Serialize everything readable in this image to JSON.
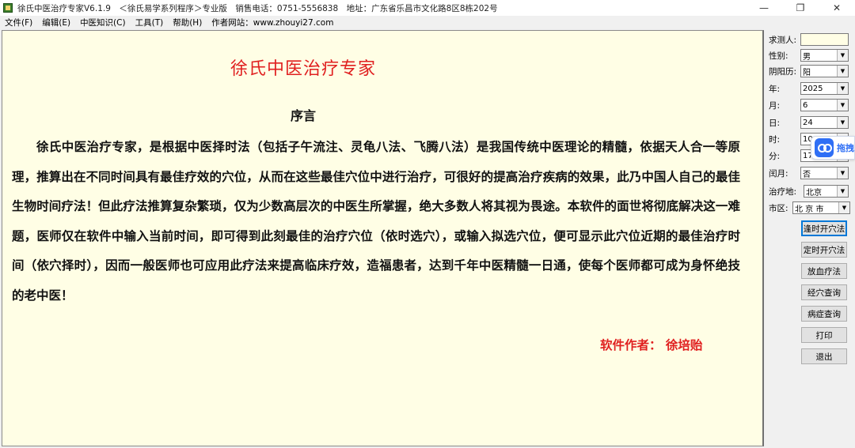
{
  "window": {
    "title": "徐氏中医治疗专家V6.1.9　＜徐氏易学系列程序＞专业版　销售电话：0751-5556838　地址：广东省乐昌市文化路8区8栋202号",
    "minimize_glyph": "—",
    "maximize_glyph": "❐",
    "close_glyph": "✕"
  },
  "menu": {
    "items": [
      "文件(F)",
      "编辑(E)",
      "中医知识(C)",
      "工具(T)",
      "帮助(H)"
    ],
    "website": "作者网站：www.zhouyi27.com"
  },
  "document": {
    "title": "徐氏中医治疗专家",
    "heading": "序言",
    "body": "徐氏中医治疗专家，是根据中医择时法（包括子午流注、灵龟八法、飞腾八法）是我国传统中医理论的精髓，依据天人合一等原理，推算出在不同时间具有最佳疗效的穴位，从而在这些最佳穴位中进行治疗，可很好的提高治疗疾病的效果，此乃中国人自己的最佳生物时间疗法！但此疗法推算复杂繁琐，仅为少数高层次的中医生所掌握，绝大多数人将其视为畏途。本软件的面世将彻底解决这一难题，医师仅在软件中输入当前时间，即可得到此刻最佳的治疗穴位（依时选穴），或输入拟选穴位，便可显示此穴位近期的最佳治疗时间（依穴择时），因而一般医师也可应用此疗法来提高临床疗效，造福患者，达到千年中医精髓一日通，使每个医师都可成为身怀绝技的老中医！",
    "author": "软件作者：  徐培贻"
  },
  "form": {
    "requester_label": "求测人:",
    "requester_value": "",
    "gender_label": "性别:",
    "gender_value": "男",
    "calendar_label": "阴阳历:",
    "calendar_value": "阳",
    "year_label": "年:",
    "year_value": "2025",
    "month_label": "月:",
    "month_value": "6",
    "day_label": "日:",
    "day_value": "24",
    "hour_label": "时:",
    "hour_value": "10",
    "minute_label": "分:",
    "minute_value": "17",
    "leap_label": "闰月:",
    "leap_value": "否",
    "location_label": "治疗地:",
    "location_value": "北京",
    "city_label": "市区:",
    "city_value": "北 京 市"
  },
  "buttons": {
    "timed_open": "逢时开穴法",
    "fixed_open": "定时开穴法",
    "bloodletting": "放血疗法",
    "acupoint_query": "经穴查询",
    "disease_query": "病症查询",
    "print": "打印",
    "exit": "退出"
  },
  "overlay": {
    "label": "拖拽"
  },
  "colors": {
    "doc_background": "#fffee5",
    "title_red": "#e02020",
    "panel_gray": "#f0f0f0",
    "focus_blue": "#0078d7"
  }
}
